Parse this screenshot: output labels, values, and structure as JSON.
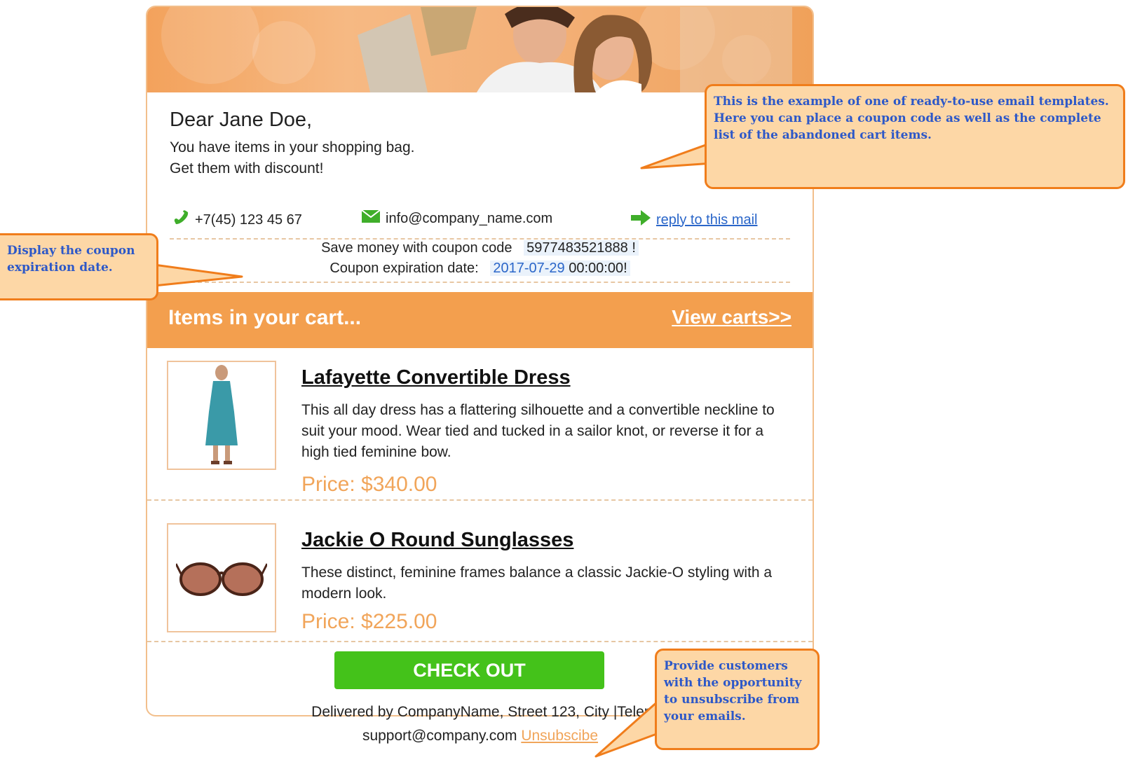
{
  "email": {
    "greeting": "Dear Jane Doe,",
    "line1": "You have items in your shopping bag.",
    "line2": "Get them with discount!",
    "phone": "+7(45) 123 45 67",
    "email_address": "info@company_name.com",
    "reply_link": "reply to this mail",
    "coupon_label": "Save money with coupon code",
    "coupon_code": "5977483521888 !",
    "expiry_label": "Coupon expiration date:",
    "expiry_date": "2017-07-29",
    "expiry_time": "00:00:00!",
    "cart_title": "Items in your cart...",
    "view_carts": "View carts>>",
    "products": [
      {
        "name": "Lafayette Convertible Dress",
        "description": "This all day dress has a flattering silhouette and a convertible neckline to suit your mood. Wear tied and tucked in a sailor knot, or reverse it for a high tied feminine bow.",
        "price": "Price: $340.00"
      },
      {
        "name": "Jackie O Round Sunglasses",
        "description": "These distinct, feminine frames balance a classic Jackie-O styling with a modern look.",
        "price": "Price: $225.00"
      }
    ],
    "checkout": "CHECK OUT",
    "footer_line1": "Delivered by CompanyName, Street 123, City |Teler",
    "footer_email": "support@company.com",
    "footer_unsubscribe": "Unsubscibe"
  },
  "callouts": {
    "top": "This is the example of one of ready-to-use email templates.\nHere you can  place a coupon  code  as well as the complete list  of the abandoned cart  items.",
    "left": "Display the coupon expiration date.",
    "bottom": "Provide customers with the opportunity to unsubscribe from your emails."
  },
  "colors": {
    "accent_orange": "#f39f4e",
    "checkout_green": "#44c21a",
    "callout_fill": "#fdd7a6",
    "callout_border": "#f07d1b",
    "callout_text": "#2d58c8",
    "link_blue": "#2a66c9",
    "price_orange": "#f1a55a"
  },
  "icons": [
    "phone-icon",
    "envelope-icon",
    "arrow-right-icon"
  ]
}
